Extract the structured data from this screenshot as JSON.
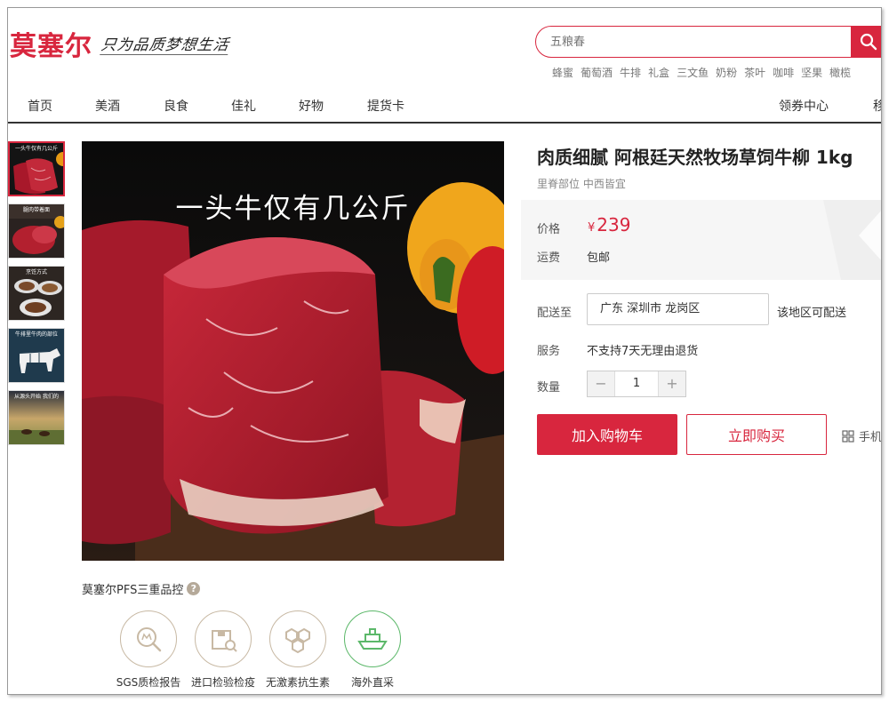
{
  "header": {
    "brand": "莫塞尔",
    "slogan": "只为品质梦想生活",
    "search_placeholder": "五粮春",
    "hot_words": [
      "蜂蜜",
      "葡萄酒",
      "牛排",
      "礼盒",
      "三文鱼",
      "奶粉",
      "茶叶",
      "咖啡",
      "坚果",
      "橄榄"
    ]
  },
  "nav": {
    "items": [
      "首页",
      "美酒",
      "良食",
      "佳礼",
      "好物",
      "提货卡"
    ],
    "right_items": [
      "领券中心",
      "移"
    ]
  },
  "gallery": {
    "main_caption": "一头牛仅有几公斤",
    "thumb_captions": [
      "一头牛仅有几公斤",
      "腿肉带着面",
      "烹饪方式",
      "牛排里牛肉的部位",
      "从源头开始 我们的"
    ]
  },
  "quality": {
    "title": "莫塞尔PFS三重品控",
    "items": [
      {
        "label": "SGS质检报告",
        "icon": "magnifier-icon"
      },
      {
        "label": "进口检验检疫",
        "icon": "package-inspect-icon"
      },
      {
        "label": "无激素抗生素",
        "icon": "hexagon-molecule-icon"
      },
      {
        "label": "海外直采",
        "icon": "ship-icon"
      }
    ]
  },
  "product": {
    "title": "肉质细腻 阿根廷天然牧场草饲牛柳 1kg",
    "subtitle": "里脊部位 中西皆宜",
    "price_label": "价格",
    "currency": "¥",
    "price": "239",
    "shipping_label": "运费",
    "shipping_value": "包邮",
    "delivery_label": "配送至",
    "delivery_address": "广东 深圳市 龙岗区",
    "delivery_note": "该地区可配送",
    "service_label": "服务",
    "service_value": "不支持7天无理由退货",
    "quantity_label": "数量",
    "quantity_minus": "−",
    "quantity_value": "1",
    "quantity_plus": "+",
    "add_to_cart": "加入购物车",
    "buy_now": "立即购买",
    "mobile_label": "手机"
  },
  "colors": {
    "accent": "#d8263e",
    "qc_border": "#c8b9a4",
    "qc_green": "#5cb86a"
  }
}
